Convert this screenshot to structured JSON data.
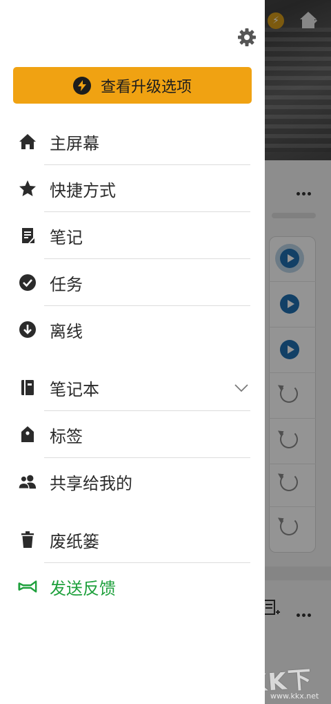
{
  "drawer": {
    "upgrade_label": "查看升级选项",
    "items": [
      {
        "label": "主屏幕",
        "icon": "home-icon"
      },
      {
        "label": "快捷方式",
        "icon": "star-icon"
      },
      {
        "label": "笔记",
        "icon": "note-icon"
      },
      {
        "label": "任务",
        "icon": "task-check-icon"
      },
      {
        "label": "离线",
        "icon": "offline-download-icon"
      },
      {
        "label": "笔记本",
        "icon": "notebook-icon"
      },
      {
        "label": "标签",
        "icon": "tag-icon"
      },
      {
        "label": "共享给我的",
        "icon": "shared-people-icon"
      },
      {
        "label": "废纸篓",
        "icon": "trash-icon"
      },
      {
        "label": "发送反馈",
        "icon": "megaphone-icon"
      }
    ]
  },
  "watermark": {
    "text": "KK下载",
    "url": "www.kkx.net"
  },
  "colors": {
    "accent": "#f0a212",
    "feedback_green": "#1ea03c",
    "icon_dark": "#2b2b2b"
  }
}
